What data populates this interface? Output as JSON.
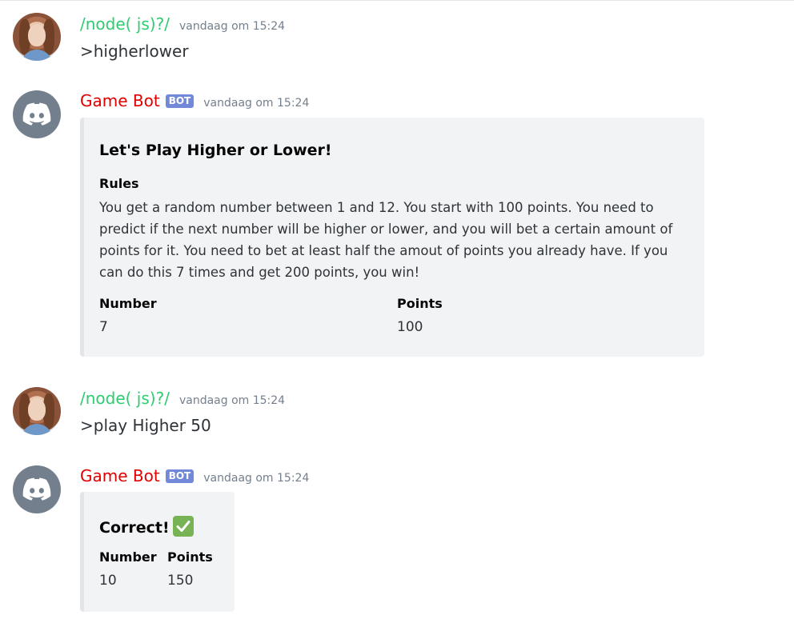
{
  "colors": {
    "user_name": "#2ecc71",
    "bot_name": "#e00000",
    "bot_tag_bg": "#7289da",
    "embed_bg": "#f2f3f5",
    "embed_border": "#e3e5e8",
    "timestamp": "#747f8d"
  },
  "messages": [
    {
      "author": "/node( js)?/",
      "timestamp": "vandaag om 15:24",
      "text": ">higherlower",
      "avatar_icon": "user-avatar"
    },
    {
      "author": "Game Bot",
      "bot_tag": "BOT",
      "timestamp": "vandaag om 15:24",
      "avatar_icon": "discord-logo-icon",
      "embed": {
        "title": "Let's Play Higher or Lower!",
        "description_title": "Rules",
        "description": "You get a random number between 1 and 12. You start with 100 points. You need to predict if the next number will be higher or lower, and you will bet a certain amount of points for it. You need to bet at least half the amout of points you already have. If you can do this 7 times and get 200 points, you win!",
        "fields": [
          {
            "name": "Number",
            "value": "7"
          },
          {
            "name": "Points",
            "value": "100"
          }
        ]
      }
    },
    {
      "author": "/node( js)?/",
      "timestamp": "vandaag om 15:24",
      "text": ">play Higher 50",
      "avatar_icon": "user-avatar"
    },
    {
      "author": "Game Bot",
      "bot_tag": "BOT",
      "timestamp": "vandaag om 15:24",
      "avatar_icon": "discord-logo-icon",
      "embed": {
        "title": "Correct!",
        "title_icon": "white-check-mark-icon",
        "fields": [
          {
            "name": "Number",
            "value": "10"
          },
          {
            "name": "Points",
            "value": "150"
          }
        ]
      }
    }
  ]
}
